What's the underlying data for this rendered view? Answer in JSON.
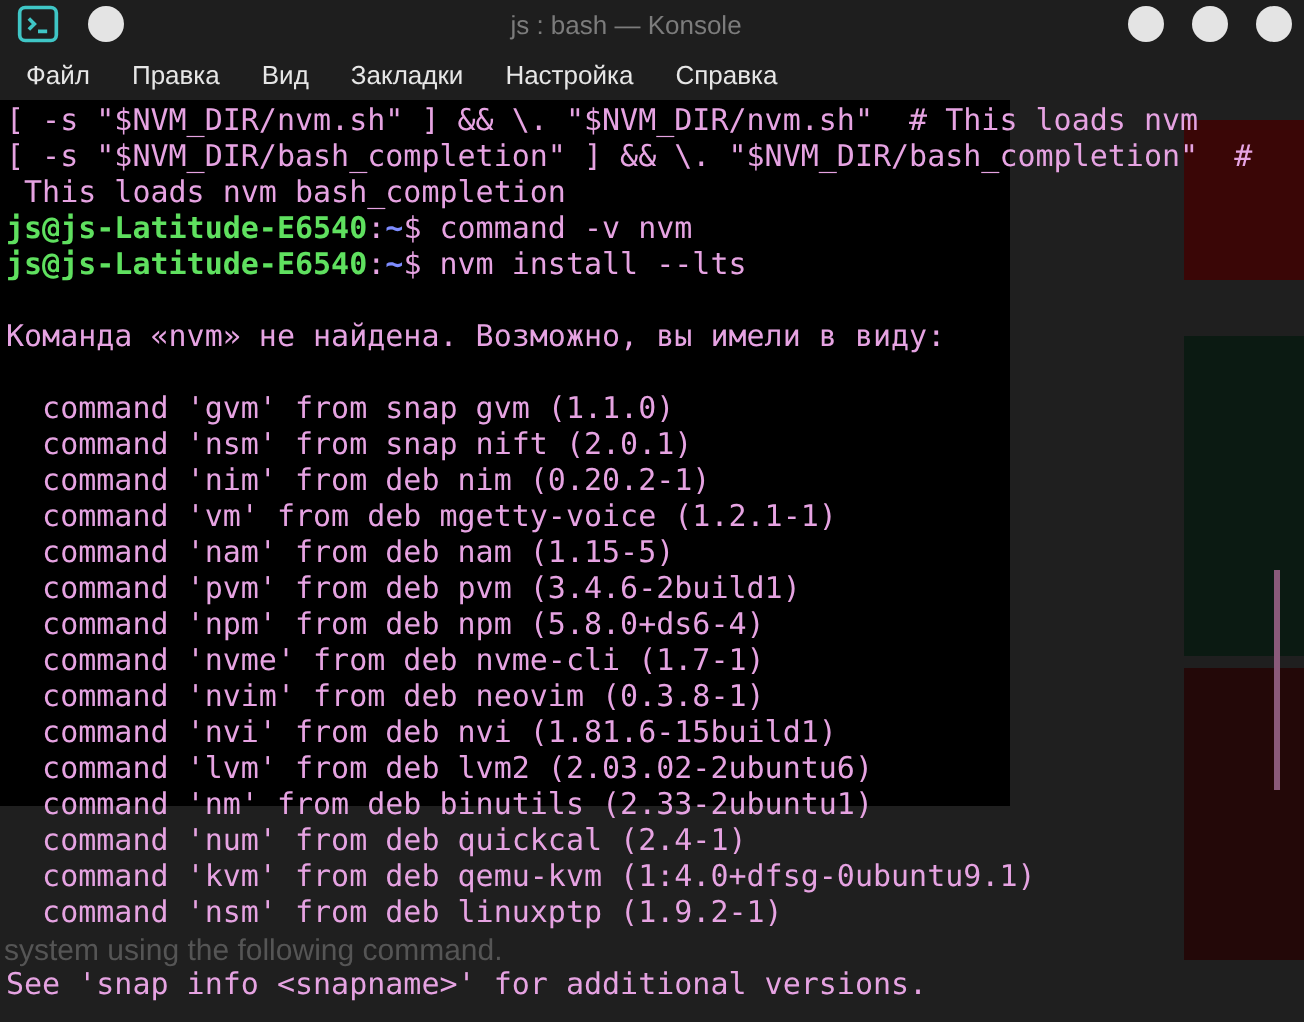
{
  "window": {
    "title": "js : bash — Konsole"
  },
  "menu": [
    "Файл",
    "Правка",
    "Вид",
    "Закладки",
    "Настройка",
    "Справка"
  ],
  "terminal_lines": [
    {
      "kind": "output",
      "text": "[ -s \"$NVM_DIR/nvm.sh\" ] && \\. \"$NVM_DIR/nvm.sh\"  # This loads nvm"
    },
    {
      "kind": "output",
      "text": "[ -s \"$NVM_DIR/bash_completion\" ] && \\. \"$NVM_DIR/bash_completion\"  #"
    },
    {
      "kind": "output",
      "text": " This loads nvm bash_completion"
    },
    {
      "kind": "prompt",
      "user": "js@js-Latitude-E6540",
      "colon": ":",
      "path": "~",
      "symbol": "$",
      "text": "command -v nvm"
    },
    {
      "kind": "prompt",
      "user": "js@js-Latitude-E6540",
      "colon": ":",
      "path": "~",
      "symbol": "$",
      "text": "nvm install --lts"
    },
    {
      "kind": "blank"
    },
    {
      "kind": "output",
      "text": "Команда «nvm» не найдена. Возможно, вы имели в виду:"
    },
    {
      "kind": "blank"
    },
    {
      "kind": "output",
      "text": "  command 'gvm' from snap gvm (1.1.0)"
    },
    {
      "kind": "output",
      "text": "  command 'nsm' from snap nift (2.0.1)"
    },
    {
      "kind": "output",
      "text": "  command 'nim' from deb nim (0.20.2-1)"
    },
    {
      "kind": "output",
      "text": "  command 'vm' from deb mgetty-voice (1.2.1-1)"
    },
    {
      "kind": "output",
      "text": "  command 'nam' from deb nam (1.15-5)"
    },
    {
      "kind": "output",
      "text": "  command 'pvm' from deb pvm (3.4.6-2build1)"
    },
    {
      "kind": "output",
      "text": "  command 'npm' from deb npm (5.8.0+ds6-4)"
    },
    {
      "kind": "output",
      "text": "  command 'nvme' from deb nvme-cli (1.7-1)"
    },
    {
      "kind": "output",
      "text": "  command 'nvim' from deb neovim (0.3.8-1)"
    },
    {
      "kind": "output",
      "text": "  command 'nvi' from deb nvi (1.81.6-15build1)"
    },
    {
      "kind": "output",
      "text": "  command 'lvm' from deb lvm2 (2.03.02-2ubuntu6)"
    },
    {
      "kind": "output",
      "text": "  command 'nm' from deb binutils (2.33-2ubuntu1)"
    },
    {
      "kind": "output",
      "text": "  command 'num' from deb quickcal (2.4-1)"
    },
    {
      "kind": "output",
      "text": "  command 'kvm' from deb qemu-kvm (1:4.0+dfsg-0ubuntu9.1)"
    },
    {
      "kind": "output",
      "text": "  command 'nsm' from deb linuxptp (1.9.2-1)"
    },
    {
      "kind": "blank"
    },
    {
      "kind": "output",
      "text": "See 'snap info <snapname>' for additional versions."
    }
  ],
  "background_page": {
    "text": "system using the following command."
  }
}
